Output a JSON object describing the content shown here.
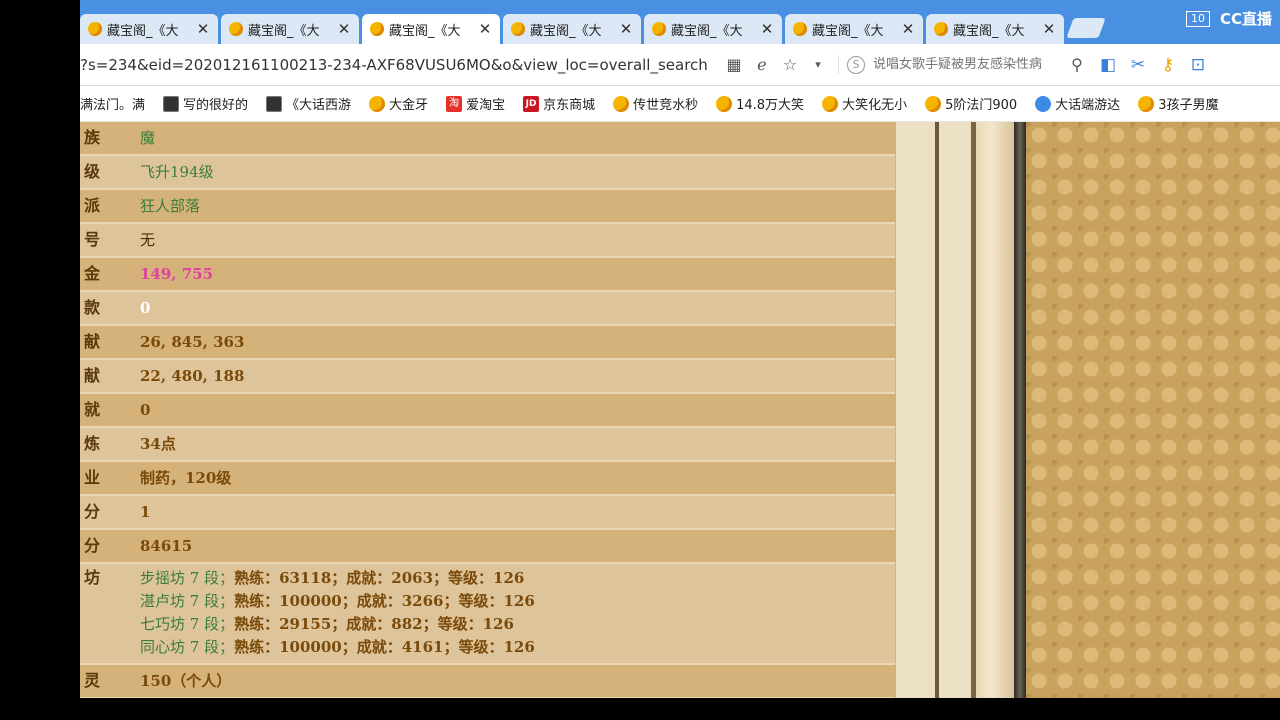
{
  "tabs": [
    {
      "title": "藏宝阁_《大",
      "active": false
    },
    {
      "title": "藏宝阁_《大",
      "active": false
    },
    {
      "title": "藏宝阁_《大",
      "active": true
    },
    {
      "title": "藏宝阁_《大",
      "active": false
    },
    {
      "title": "藏宝阁_《大",
      "active": false
    },
    {
      "title": "藏宝阁_《大",
      "active": false
    },
    {
      "title": "藏宝阁_《大",
      "active": false
    }
  ],
  "topbar": {
    "tab_count": "10",
    "live_label": "CC直播"
  },
  "address": {
    "url": "?s=234&eid=202012161100213-234-AXF68VUSU6MO&o&view_loc=overall_search",
    "search_placeholder": "说唱女歌手疑被男友感染性病"
  },
  "bookmarks": [
    {
      "label": "满法门。满",
      "icon": "none"
    },
    {
      "label": "写的很好的",
      "icon": "dark"
    },
    {
      "label": "《大话西游",
      "icon": "dark"
    },
    {
      "label": "大金牙",
      "icon": "star"
    },
    {
      "label": "爱淘宝",
      "icon": "taobao",
      "glyph": "淘"
    },
    {
      "label": "京东商城",
      "icon": "jd",
      "glyph": "JD"
    },
    {
      "label": "传世竞水秒",
      "icon": "star"
    },
    {
      "label": "14.8万大笑",
      "icon": "star"
    },
    {
      "label": "大笑化无小",
      "icon": "star"
    },
    {
      "label": "5阶法门900",
      "icon": "star"
    },
    {
      "label": "大话端游达",
      "icon": "blue"
    },
    {
      "label": "3孩子男魔",
      "icon": "star"
    }
  ],
  "rows": [
    {
      "label": "族",
      "value": "魔",
      "style": "green"
    },
    {
      "label": "级",
      "value": "飞升194级",
      "style": "green"
    },
    {
      "label": "派",
      "value": "狂人部落",
      "style": "green"
    },
    {
      "label": "号",
      "value": "无",
      "style": "dark"
    },
    {
      "label": "金",
      "value": "149, 755",
      "style": "pink"
    },
    {
      "label": "款",
      "value": "0",
      "style": "white"
    },
    {
      "label": "献",
      "value": "26, 845, 363",
      "style": "brown"
    },
    {
      "label": "献",
      "value": "22, 480, 188",
      "style": "brown"
    },
    {
      "label": "就",
      "value": "0",
      "style": "brown"
    },
    {
      "label": "炼",
      "value": "34点",
      "style": "brown"
    },
    {
      "label": "业",
      "value": "制药，120级",
      "style": "brown"
    },
    {
      "label": "分",
      "value": "1",
      "style": "brown"
    },
    {
      "label": "分",
      "value": "84615",
      "style": "brown"
    }
  ],
  "workshops": {
    "label": "坊",
    "items": [
      {
        "name": "步摇坊 7 段；",
        "info": "熟练：63118；成就：2063；等级：126"
      },
      {
        "name": "湛卢坊 7 段；",
        "info": "熟练：100000；成就：3266；等级：126"
      },
      {
        "name": "七巧坊 7 段；",
        "info": "熟练：29155；成就：882；等级：126"
      },
      {
        "name": "同心坊 7 段；",
        "info": "熟练：100000；成就：4161；等级：126"
      }
    ]
  },
  "last_row": {
    "label": "灵",
    "value": "150（个人）",
    "style": "brown"
  }
}
